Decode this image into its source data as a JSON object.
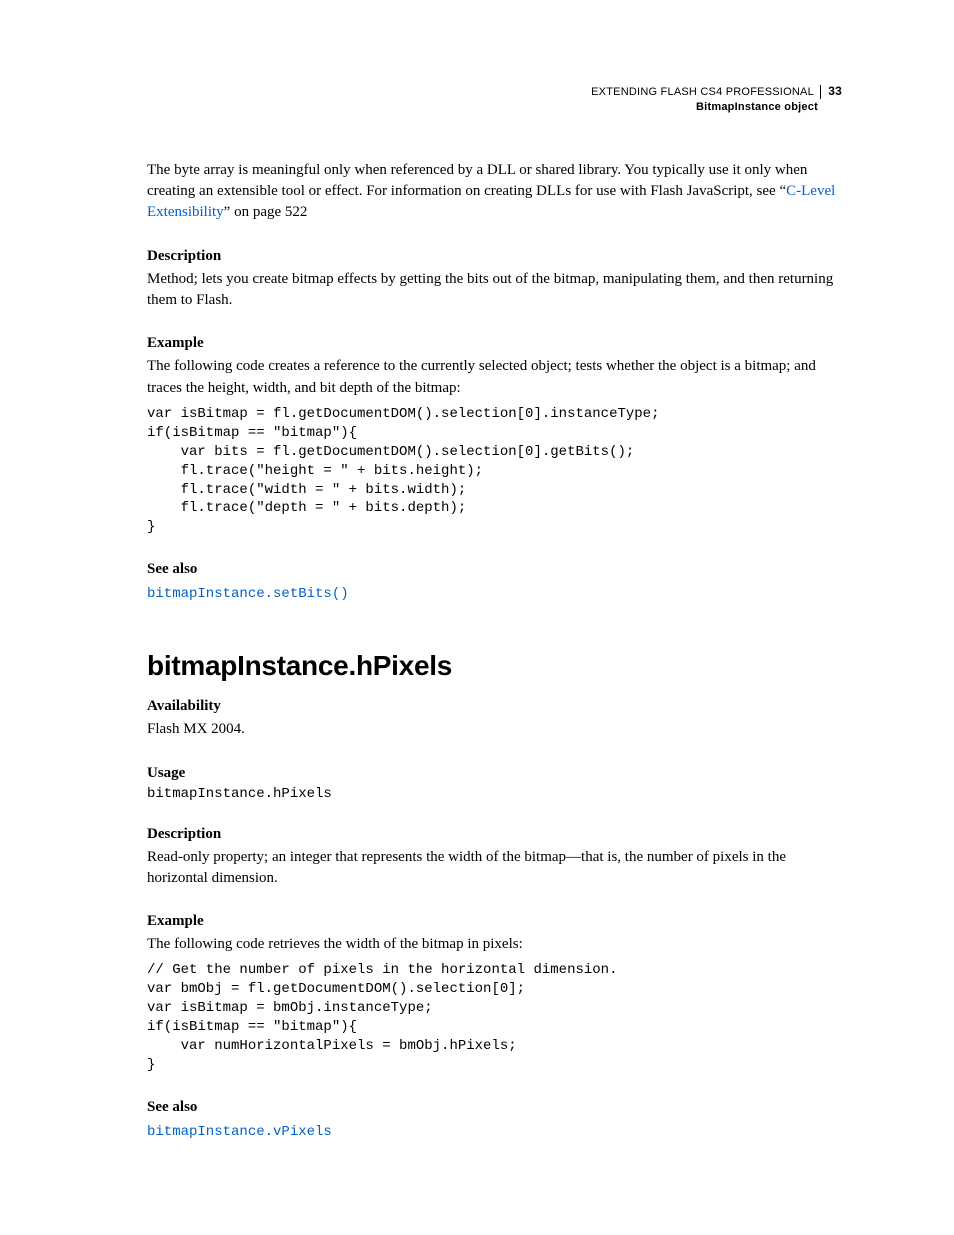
{
  "header": {
    "doc_title": "EXTENDING FLASH CS4 PROFESSIONAL",
    "page_number": "33",
    "section_title": "BitmapInstance object"
  },
  "intro": {
    "p1a": "The byte array is meaningful only when referenced by a DLL or shared library. You typically use it only when creating an extensible tool or effect. For information on creating DLLs for use with Flash JavaScript, see “",
    "p1_link": "C-Level Extensibility",
    "p1b": "” on page 522"
  },
  "desc1_label": "Description",
  "desc1_text": "Method; lets you create bitmap effects by getting the bits out of the bitmap, manipulating them, and then returning them to Flash.",
  "ex1_label": "Example",
  "ex1_text": "The following code creates a reference to the currently selected object; tests whether the object is a bitmap; and traces the height, width, and bit depth of the bitmap:",
  "ex1_code": "var isBitmap = fl.getDocumentDOM().selection[0].instanceType;\nif(isBitmap == \"bitmap\"){\n    var bits = fl.getDocumentDOM().selection[0].getBits();\n    fl.trace(\"height = \" + bits.height);\n    fl.trace(\"width = \" + bits.width);\n    fl.trace(\"depth = \" + bits.depth);\n}",
  "see1_label": "See also",
  "see1_link": "bitmapInstance.setBits()",
  "h1": "bitmapInstance.hPixels",
  "avail_label": "Availability",
  "avail_text": "Flash MX 2004.",
  "usage_label": "Usage",
  "usage_code": "bitmapInstance.hPixels",
  "desc2_label": "Description",
  "desc2_text": "Read-only property; an integer that represents the width of the bitmap—that is, the number of pixels in the horizontal dimension.",
  "ex2_label": "Example",
  "ex2_text": "The following code retrieves the width of the bitmap in pixels:",
  "ex2_code": "// Get the number of pixels in the horizontal dimension.\nvar bmObj = fl.getDocumentDOM().selection[0];\nvar isBitmap = bmObj.instanceType;\nif(isBitmap == \"bitmap\"){\n    var numHorizontalPixels = bmObj.hPixels;\n}",
  "see2_label": "See also",
  "see2_link": "bitmapInstance.vPixels"
}
